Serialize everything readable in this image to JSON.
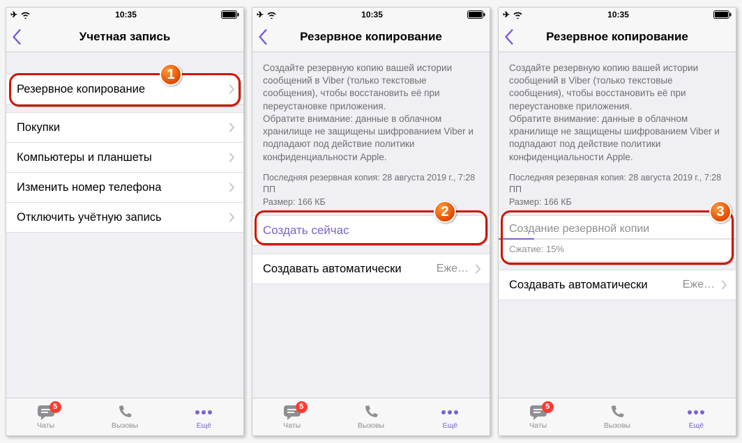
{
  "status": {
    "time": "10:35"
  },
  "screen1": {
    "title": "Учетная запись",
    "rows": {
      "backup": "Резервное копирование",
      "purchases": "Покупки",
      "computers": "Компьютеры и планшеты",
      "change_number": "Изменить номер телефона",
      "deactivate": "Отключить учётную запись"
    }
  },
  "screen2": {
    "title": "Резервное копирование",
    "info": "Создайте резервную копию вашей истории сообщений в Viber (только текстовые сообщения), чтобы восстановить её при переустановке приложения.\nОбратите внимание: данные в облачном хранилище не защищены шифрованием Viber и подпадают под действие политики конфиденциальности Apple.",
    "last_backup": "Последняя резервная копия: 28 августа 2019 г., 7:28 ПП",
    "size": "Размер: 166 КБ",
    "create_now": "Создать сейчас",
    "auto_label": "Создавать автоматически",
    "auto_value": "Еже…"
  },
  "screen3": {
    "title": "Резервное копирование",
    "info": "Создайте резервную копию вашей истории сообщений в Viber (только текстовые сообщения), чтобы восстановить её при переустановке приложения.\nОбратите внимание: данные в облачном хранилище не защищены шифрованием Viber и подпадают под действие политики конфиденциальности Apple.",
    "last_backup": "Последняя резервная копия: 28 августа 2019 г., 7:28 ПП",
    "size": "Размер: 166 КБ",
    "progress_title": "Создание резервной копии",
    "compress_label": "Сжатие: 15%",
    "progress_percent": 15,
    "auto_label": "Создавать автоматически",
    "auto_value": "Еже…"
  },
  "tabs": {
    "chats": "Чаты",
    "calls": "Вызовы",
    "more": "Ещё",
    "badge": "5"
  },
  "steps": {
    "s1": "1",
    "s2": "2",
    "s3": "3"
  }
}
